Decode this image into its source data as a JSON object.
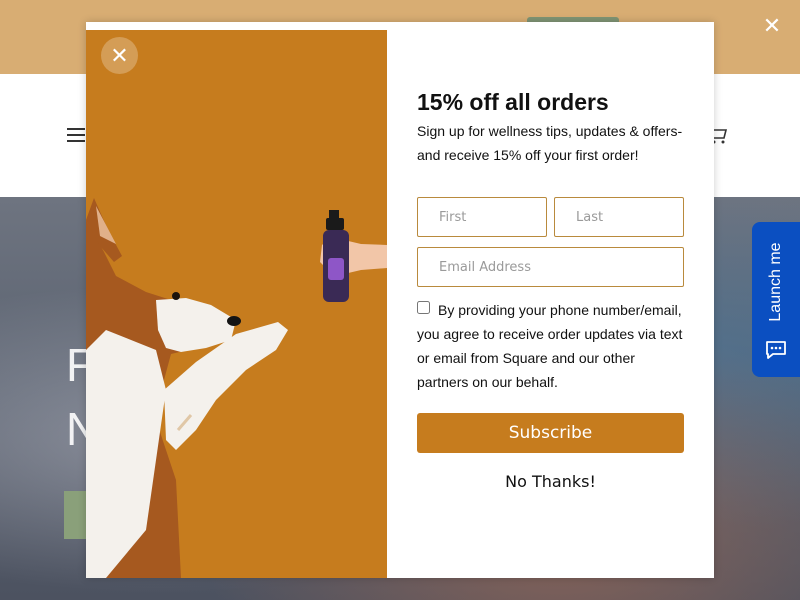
{
  "announcement_bar": {
    "close_icon": "close-icon",
    "color": "#d8ad73"
  },
  "header": {
    "menu_icon": "hamburger-icon",
    "cart_icon": "cart-icon"
  },
  "hero": {
    "line1": "F",
    "line2": "N"
  },
  "chat_launcher": {
    "label": "Launch me",
    "icon": "chat-bubble-icon",
    "color": "#0b4fc1"
  },
  "modal": {
    "close_icon": "close-icon",
    "title": "15% off all orders",
    "subtitle": "Sign up for wellness tips, updates & offers- and receive 15% off your first order!",
    "first_placeholder": "First",
    "last_placeholder": "Last",
    "email_placeholder": "Email Address",
    "consent_text": "By providing your phone number/email, you agree to receive order updates via text or email from Square and our other partners on our behalf.",
    "subscribe_label": "Subscribe",
    "decline_label": "No Thanks!",
    "accent_color": "#c67c1e"
  }
}
